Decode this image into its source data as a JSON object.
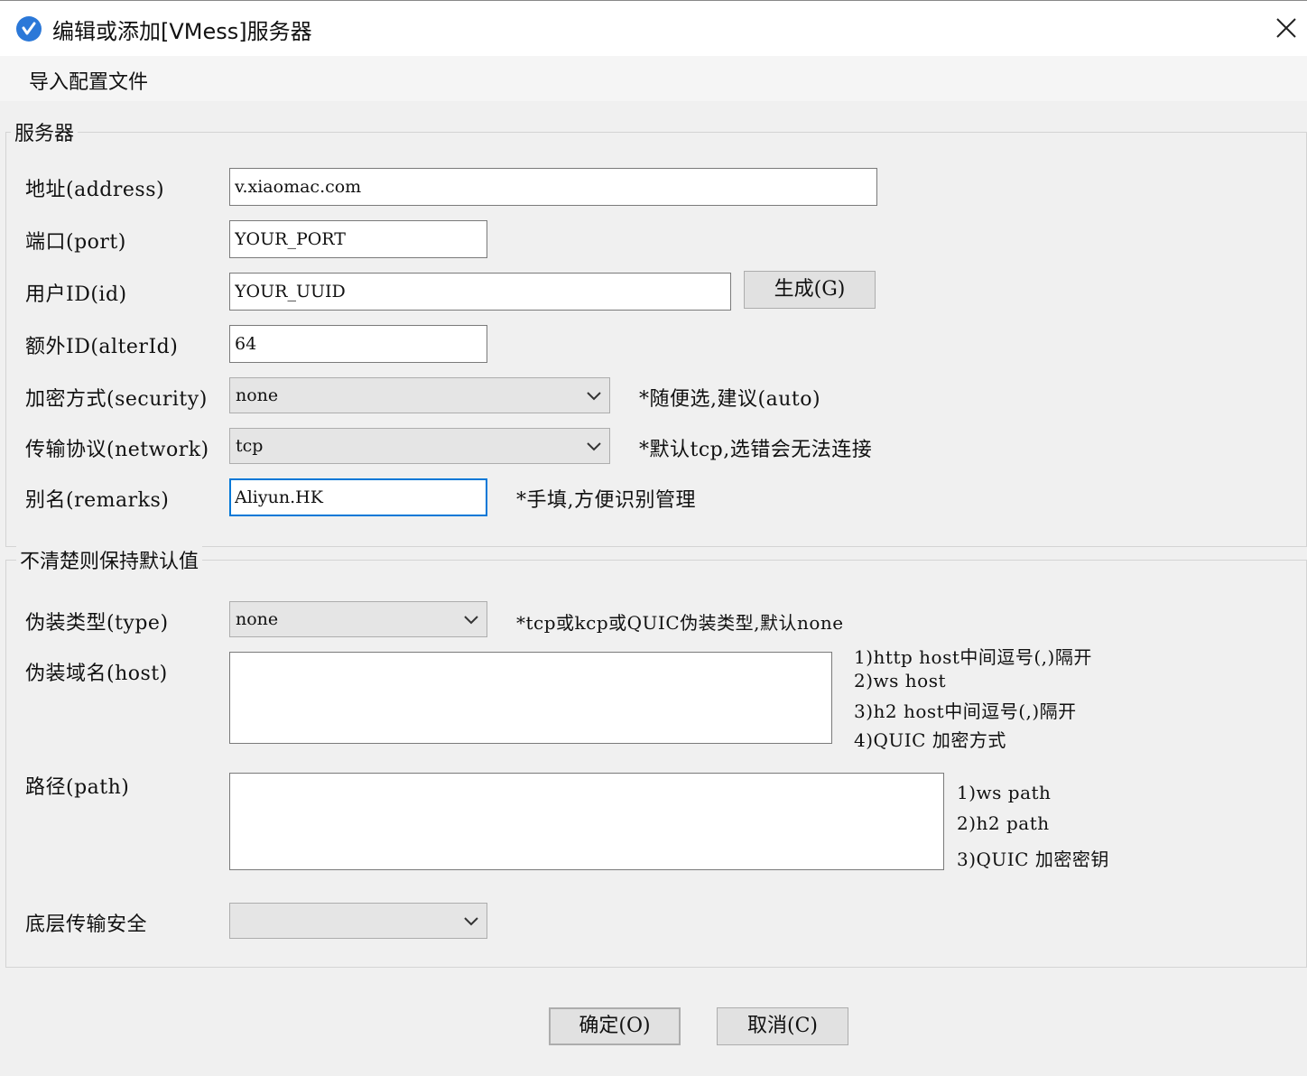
{
  "window": {
    "title": "编辑或添加[VMess]服务器",
    "close_label": "✕"
  },
  "menu": {
    "import_config": "导入配置文件"
  },
  "server_group": {
    "legend": "服务器",
    "address": {
      "label": "地址(address)",
      "value": "v.xiaomac.com"
    },
    "port": {
      "label": "端口(port)",
      "value": "YOUR_PORT"
    },
    "user_id": {
      "label": "用户ID(id)",
      "value": "YOUR_UUID",
      "generate_button": "生成(G)"
    },
    "alter_id": {
      "label": "额外ID(alterId)",
      "value": "64"
    },
    "security": {
      "label": "加密方式(security)",
      "selected": "none",
      "hint": "*随便选,建议(auto)"
    },
    "network": {
      "label": "传输协议(network)",
      "selected": "tcp",
      "hint": "*默认tcp,选错会无法连接"
    },
    "remarks": {
      "label": "别名(remarks)",
      "value": "Aliyun.HK",
      "hint": "*手填,方便识别管理"
    }
  },
  "advanced_group": {
    "legend": "不清楚则保持默认值",
    "type": {
      "label": "伪装类型(type)",
      "selected": "none",
      "hint": "*tcp或kcp或QUIC伪装类型,默认none"
    },
    "host": {
      "label": "伪装域名(host)",
      "value": "",
      "hints": [
        "1)http host中间逗号(,)隔开",
        "2)ws host",
        "3)h2 host中间逗号(,)隔开",
        "4)QUIC 加密方式"
      ]
    },
    "path": {
      "label": "路径(path)",
      "value": "",
      "hints": [
        "1)ws path",
        "2)h2 path",
        "3)QUIC 加密密钥"
      ]
    },
    "tls": {
      "label": "底层传输安全",
      "selected": ""
    }
  },
  "footer": {
    "ok_button": "确定(O)",
    "cancel_button": "取消(C)"
  },
  "colors": {
    "accent": "#0078d7",
    "app_icon": "#2b78d8",
    "background": "#f0f0f0"
  }
}
